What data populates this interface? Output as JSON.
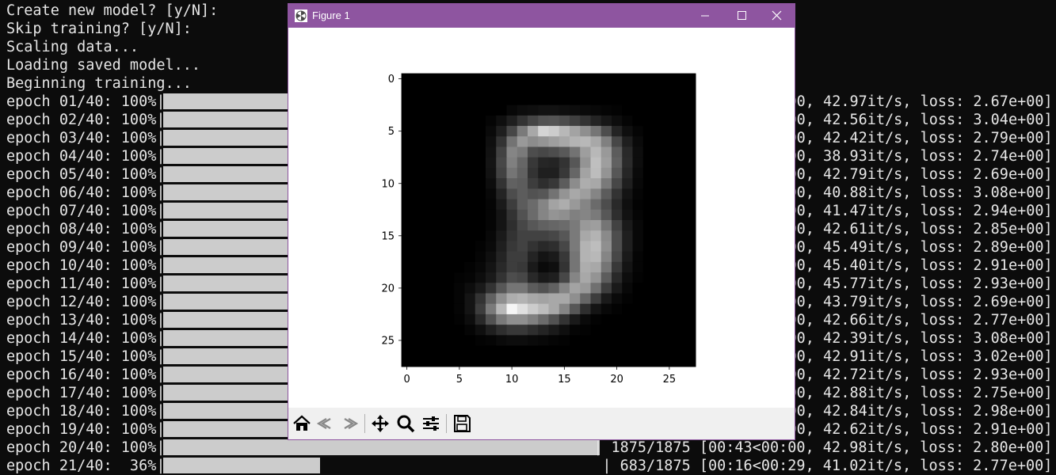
{
  "terminal": {
    "prompts": [
      "Create new model? [y/N]:",
      "Skip training? [y/N]:",
      "Scaling data...",
      "Loading saved model...",
      "Beginning training..."
    ],
    "epochs": [
      {
        "label": "epoch 01/40: 100%|",
        "progress": 1.0,
        "tail": "00, 42.97it/s, loss: 2.67e+00]"
      },
      {
        "label": "epoch 02/40: 100%|",
        "progress": 1.0,
        "tail": "00, 42.56it/s, loss: 3.04e+00]"
      },
      {
        "label": "epoch 03/40: 100%|",
        "progress": 1.0,
        "tail": "00, 42.42it/s, loss: 2.79e+00]"
      },
      {
        "label": "epoch 04/40: 100%|",
        "progress": 1.0,
        "tail": "00, 38.93it/s, loss: 2.74e+00]"
      },
      {
        "label": "epoch 05/40: 100%|",
        "progress": 1.0,
        "tail": "00, 42.79it/s, loss: 2.69e+00]"
      },
      {
        "label": "epoch 06/40: 100%|",
        "progress": 1.0,
        "tail": "00, 40.88it/s, loss: 3.08e+00]"
      },
      {
        "label": "epoch 07/40: 100%|",
        "progress": 1.0,
        "tail": "00, 41.47it/s, loss: 2.94e+00]"
      },
      {
        "label": "epoch 08/40: 100%|",
        "progress": 1.0,
        "tail": "00, 42.61it/s, loss: 2.85e+00]"
      },
      {
        "label": "epoch 09/40: 100%|",
        "progress": 1.0,
        "tail": "00, 45.49it/s, loss: 2.89e+00]"
      },
      {
        "label": "epoch 10/40: 100%|",
        "progress": 1.0,
        "tail": "00, 45.40it/s, loss: 2.91e+00]"
      },
      {
        "label": "epoch 11/40: 100%|",
        "progress": 1.0,
        "tail": "00, 45.77it/s, loss: 2.93e+00]"
      },
      {
        "label": "epoch 12/40: 100%|",
        "progress": 1.0,
        "tail": "00, 43.79it/s, loss: 2.69e+00]"
      },
      {
        "label": "epoch 13/40: 100%|",
        "progress": 1.0,
        "tail": "00, 42.66it/s, loss: 2.77e+00]"
      },
      {
        "label": "epoch 14/40: 100%|",
        "progress": 1.0,
        "tail": "00, 42.39it/s, loss: 3.08e+00]"
      },
      {
        "label": "epoch 15/40: 100%|",
        "progress": 1.0,
        "tail": "00, 42.91it/s, loss: 3.02e+00]"
      },
      {
        "label": "epoch 16/40: 100%|",
        "progress": 1.0,
        "tail": "00, 42.72it/s, loss: 2.93e+00]"
      },
      {
        "label": "epoch 17/40: 100%|",
        "progress": 1.0,
        "tail": "00, 42.88it/s, loss: 2.75e+00]"
      },
      {
        "label": "epoch 18/40: 100%|",
        "progress": 1.0,
        "tail": "00, 42.84it/s, loss: 2.98e+00]"
      },
      {
        "label": "epoch 19/40: 100%|",
        "progress": 1.0,
        "tail": "00, 42.62it/s, loss: 2.91e+00]"
      },
      {
        "label": "epoch 20/40: 100%|",
        "progress": 1.0,
        "tail": "| 1875/1875 [00:43<00:00, 42.98it/s, loss: 2.80e+00]"
      },
      {
        "label": "epoch 21/40:  36%|",
        "progress": 0.36,
        "tail": "| 683/1875 [00:16<00:29, 41.02it/s, loss: 2.77e+00]"
      }
    ]
  },
  "window": {
    "title": "Figure 1",
    "titlebar_color": "#8e55a0",
    "icons": [
      "app-icon",
      "minimize-icon",
      "maximize-icon",
      "close-icon"
    ]
  },
  "toolbar": {
    "buttons": [
      "home-icon",
      "back-icon",
      "forward-icon",
      "pan-icon",
      "zoom-icon",
      "configure-subplots-icon",
      "save-icon"
    ]
  },
  "chart_data": {
    "type": "heatmap",
    "colormap": "gray",
    "xlim": [
      -0.5,
      27.5
    ],
    "ylim": [
      27.5,
      -0.5
    ],
    "xticks": [
      "0",
      "5",
      "10",
      "15",
      "20",
      "25"
    ],
    "yticks": [
      "0",
      "5",
      "10",
      "15",
      "20",
      "25"
    ],
    "values": [
      [
        0,
        0,
        0,
        0,
        0,
        0,
        0,
        0,
        0,
        0,
        0,
        0,
        0,
        0,
        0,
        0,
        0,
        0,
        0,
        0,
        0,
        0,
        0,
        0,
        0,
        0,
        0,
        0
      ],
      [
        0,
        0,
        0,
        0,
        0,
        0,
        0,
        0,
        0,
        0,
        0,
        0,
        0,
        0,
        0,
        0,
        0,
        0,
        0,
        0,
        0,
        0,
        0,
        0,
        0,
        0,
        0,
        0
      ],
      [
        0,
        0,
        0,
        0,
        0,
        0,
        0,
        0,
        0,
        0,
        0,
        0,
        0,
        0,
        0,
        0,
        0,
        0,
        0,
        0,
        0,
        0,
        0,
        0,
        0,
        0,
        0,
        0
      ],
      [
        0,
        0,
        0,
        0,
        0,
        0,
        0,
        0,
        0,
        0,
        0.03,
        0.05,
        0.06,
        0.07,
        0.07,
        0.06,
        0.05,
        0.04,
        0.03,
        0.02,
        0.01,
        0,
        0,
        0,
        0,
        0,
        0,
        0
      ],
      [
        0,
        0,
        0,
        0,
        0,
        0,
        0,
        0,
        0.02,
        0.06,
        0.12,
        0.2,
        0.27,
        0.32,
        0.33,
        0.3,
        0.25,
        0.2,
        0.14,
        0.09,
        0.05,
        0.02,
        0,
        0,
        0,
        0,
        0,
        0
      ],
      [
        0,
        0,
        0,
        0,
        0,
        0,
        0,
        0,
        0.04,
        0.12,
        0.28,
        0.48,
        0.66,
        0.83,
        0.8,
        0.72,
        0.64,
        0.56,
        0.46,
        0.3,
        0.14,
        0.06,
        0.02,
        0,
        0,
        0,
        0,
        0
      ],
      [
        0,
        0,
        0,
        0,
        0,
        0,
        0,
        0,
        0.06,
        0.2,
        0.45,
        0.6,
        0.55,
        0.58,
        0.62,
        0.66,
        0.7,
        0.72,
        0.66,
        0.5,
        0.28,
        0.12,
        0.04,
        0,
        0,
        0,
        0,
        0
      ],
      [
        0,
        0,
        0,
        0,
        0,
        0,
        0,
        0,
        0.07,
        0.26,
        0.52,
        0.48,
        0.3,
        0.28,
        0.3,
        0.35,
        0.45,
        0.62,
        0.72,
        0.6,
        0.36,
        0.16,
        0.05,
        0,
        0,
        0,
        0,
        0
      ],
      [
        0,
        0,
        0,
        0,
        0,
        0,
        0,
        0,
        0.08,
        0.28,
        0.5,
        0.4,
        0.22,
        0.15,
        0.14,
        0.2,
        0.34,
        0.58,
        0.75,
        0.62,
        0.38,
        0.17,
        0.05,
        0,
        0,
        0,
        0,
        0
      ],
      [
        0,
        0,
        0,
        0,
        0,
        0,
        0,
        0,
        0.07,
        0.26,
        0.46,
        0.38,
        0.2,
        0.12,
        0.12,
        0.22,
        0.4,
        0.64,
        0.74,
        0.58,
        0.34,
        0.15,
        0.04,
        0,
        0,
        0,
        0,
        0
      ],
      [
        0,
        0,
        0,
        0,
        0,
        0,
        0,
        0,
        0.05,
        0.2,
        0.38,
        0.36,
        0.24,
        0.18,
        0.22,
        0.36,
        0.55,
        0.68,
        0.66,
        0.48,
        0.28,
        0.12,
        0.03,
        0,
        0,
        0,
        0,
        0
      ],
      [
        0,
        0,
        0,
        0,
        0,
        0,
        0,
        0,
        0.03,
        0.14,
        0.3,
        0.36,
        0.32,
        0.34,
        0.45,
        0.58,
        0.66,
        0.62,
        0.52,
        0.36,
        0.2,
        0.08,
        0.02,
        0,
        0,
        0,
        0,
        0
      ],
      [
        0,
        0,
        0,
        0,
        0,
        0,
        0,
        0,
        0.02,
        0.1,
        0.24,
        0.36,
        0.42,
        0.52,
        0.64,
        0.68,
        0.6,
        0.52,
        0.42,
        0.3,
        0.16,
        0.06,
        0.01,
        0,
        0,
        0,
        0,
        0
      ],
      [
        0,
        0,
        0,
        0,
        0,
        0,
        0,
        0,
        0.02,
        0.08,
        0.2,
        0.32,
        0.42,
        0.52,
        0.58,
        0.56,
        0.5,
        0.52,
        0.48,
        0.34,
        0.18,
        0.07,
        0.02,
        0,
        0,
        0,
        0,
        0
      ],
      [
        0,
        0,
        0,
        0,
        0,
        0,
        0,
        0,
        0.02,
        0.08,
        0.18,
        0.28,
        0.34,
        0.38,
        0.4,
        0.42,
        0.48,
        0.6,
        0.62,
        0.46,
        0.26,
        0.1,
        0.03,
        0,
        0,
        0,
        0,
        0
      ],
      [
        0,
        0,
        0,
        0,
        0,
        0,
        0,
        0,
        0.03,
        0.1,
        0.2,
        0.26,
        0.26,
        0.26,
        0.28,
        0.34,
        0.48,
        0.66,
        0.7,
        0.54,
        0.3,
        0.12,
        0.03,
        0,
        0,
        0,
        0,
        0
      ],
      [
        0,
        0,
        0,
        0,
        0,
        0,
        0,
        0.01,
        0.04,
        0.12,
        0.22,
        0.26,
        0.2,
        0.16,
        0.18,
        0.28,
        0.48,
        0.7,
        0.74,
        0.56,
        0.3,
        0.12,
        0.03,
        0,
        0,
        0,
        0,
        0
      ],
      [
        0,
        0,
        0,
        0,
        0,
        0,
        0,
        0.02,
        0.06,
        0.14,
        0.24,
        0.24,
        0.14,
        0.08,
        0.1,
        0.22,
        0.46,
        0.7,
        0.72,
        0.52,
        0.28,
        0.1,
        0.02,
        0,
        0,
        0,
        0,
        0
      ],
      [
        0,
        0,
        0,
        0,
        0,
        0,
        0.01,
        0.03,
        0.08,
        0.16,
        0.24,
        0.22,
        0.1,
        0.04,
        0.06,
        0.2,
        0.46,
        0.68,
        0.66,
        0.46,
        0.22,
        0.08,
        0.02,
        0,
        0,
        0,
        0,
        0
      ],
      [
        0,
        0,
        0,
        0,
        0,
        0.01,
        0.02,
        0.05,
        0.1,
        0.2,
        0.3,
        0.28,
        0.16,
        0.1,
        0.12,
        0.28,
        0.52,
        0.66,
        0.58,
        0.36,
        0.16,
        0.05,
        0.01,
        0,
        0,
        0,
        0,
        0
      ],
      [
        0,
        0,
        0,
        0,
        0,
        0.02,
        0.05,
        0.1,
        0.2,
        0.34,
        0.46,
        0.46,
        0.36,
        0.32,
        0.38,
        0.52,
        0.64,
        0.6,
        0.44,
        0.24,
        0.1,
        0.03,
        0,
        0,
        0,
        0,
        0,
        0
      ],
      [
        0,
        0,
        0,
        0,
        0,
        0.02,
        0.08,
        0.2,
        0.38,
        0.56,
        0.68,
        0.7,
        0.66,
        0.64,
        0.66,
        0.66,
        0.56,
        0.4,
        0.24,
        0.1,
        0.04,
        0.01,
        0,
        0,
        0,
        0,
        0,
        0
      ],
      [
        0,
        0,
        0,
        0,
        0,
        0.02,
        0.08,
        0.24,
        0.48,
        0.72,
        0.96,
        0.88,
        0.8,
        0.74,
        0.66,
        0.52,
        0.34,
        0.18,
        0.08,
        0.03,
        0.01,
        0,
        0,
        0,
        0,
        0,
        0,
        0
      ],
      [
        0,
        0,
        0,
        0,
        0,
        0.01,
        0.05,
        0.16,
        0.32,
        0.48,
        0.56,
        0.56,
        0.5,
        0.42,
        0.32,
        0.2,
        0.1,
        0.04,
        0.01,
        0,
        0,
        0,
        0,
        0,
        0,
        0,
        0,
        0
      ],
      [
        0,
        0,
        0,
        0,
        0,
        0,
        0.02,
        0.06,
        0.12,
        0.18,
        0.22,
        0.22,
        0.18,
        0.14,
        0.1,
        0.06,
        0.02,
        0.01,
        0,
        0,
        0,
        0,
        0,
        0,
        0,
        0,
        0,
        0
      ],
      [
        0,
        0,
        0,
        0,
        0,
        0,
        0,
        0.01,
        0.02,
        0.04,
        0.05,
        0.05,
        0.04,
        0.03,
        0.02,
        0.01,
        0,
        0,
        0,
        0,
        0,
        0,
        0,
        0,
        0,
        0,
        0,
        0
      ],
      [
        0,
        0,
        0,
        0,
        0,
        0,
        0,
        0,
        0,
        0,
        0,
        0,
        0,
        0,
        0,
        0,
        0,
        0,
        0,
        0,
        0,
        0,
        0,
        0,
        0,
        0,
        0,
        0
      ],
      [
        0,
        0,
        0,
        0,
        0,
        0,
        0,
        0,
        0,
        0,
        0,
        0,
        0,
        0,
        0,
        0,
        0,
        0,
        0,
        0,
        0,
        0,
        0,
        0,
        0,
        0,
        0,
        0
      ]
    ]
  }
}
